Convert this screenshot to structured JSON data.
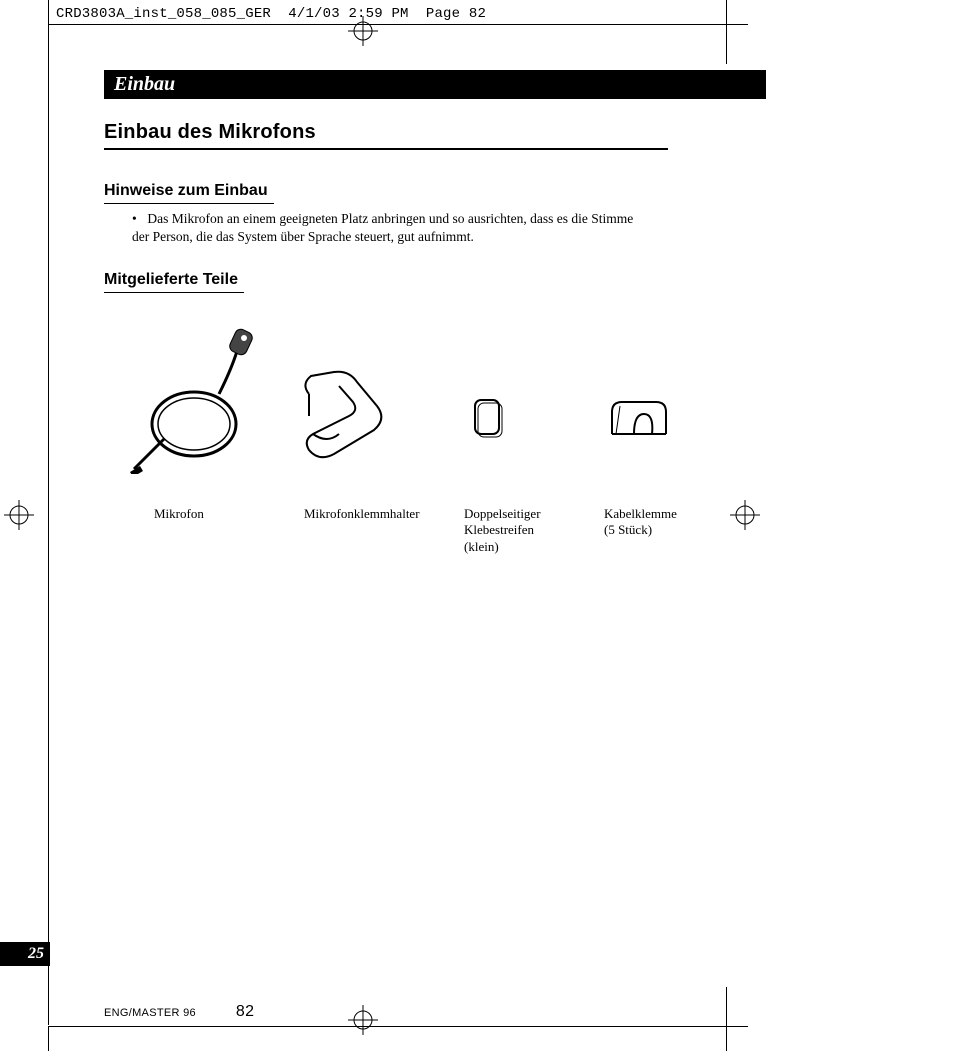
{
  "slug": "CRD3803A_inst_058_085_GER  4/1/03 2:59 PM  Page 82",
  "doc": {
    "chapter": "Einbau",
    "section": "Einbau des Mikrofons",
    "sub1": {
      "title": "Hinweise zum Einbau",
      "bullet": "Das Mikrofon an einem geeigneten Platz anbringen und so ausrichten, dass es die Stimme der Person, die das System über Sprache steuert, gut aufnimmt."
    },
    "sub2": {
      "title": "Mitgelieferte Teile",
      "parts": [
        {
          "label": "Mikrofon"
        },
        {
          "label": "Mikrofonklemmhalter"
        },
        {
          "label": "Doppelseitiger Klebestreifen (klein)"
        },
        {
          "label": "Kabelklemme (5 Stück)"
        }
      ]
    }
  },
  "side_tab": "25",
  "footer": {
    "master": "ENG/MASTER 96",
    "page": "82"
  }
}
